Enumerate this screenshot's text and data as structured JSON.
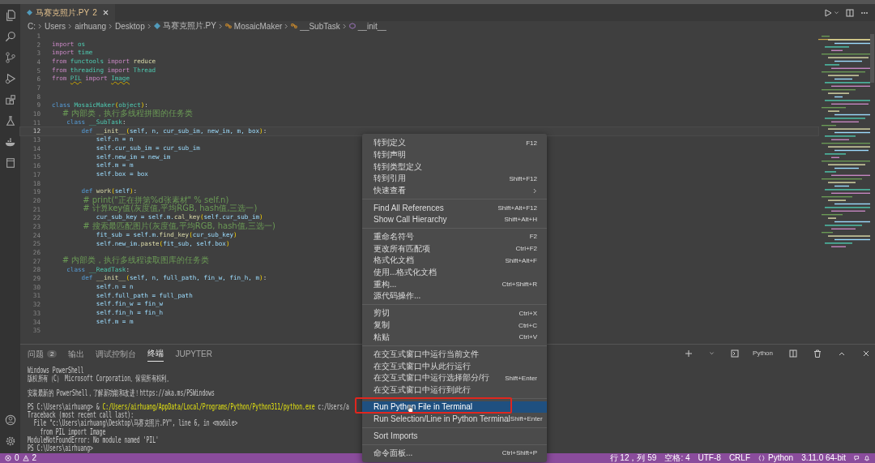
{
  "tab": {
    "title": "马赛克照片.PY",
    "problems": "2",
    "selected": true
  },
  "breadcrumbs": [
    {
      "kind": "folder",
      "text": "C:"
    },
    {
      "kind": "folder",
      "text": "Users"
    },
    {
      "kind": "folder",
      "text": "airhuang"
    },
    {
      "kind": "folder",
      "text": "Desktop"
    },
    {
      "kind": "file",
      "text": "马赛克照片.PY"
    },
    {
      "kind": "class",
      "text": "MosaicMaker"
    },
    {
      "kind": "class",
      "text": "__SubTask"
    },
    {
      "kind": "method",
      "text": "__init__"
    }
  ],
  "code_lines": [
    {
      "n": "1",
      "current": false
    },
    {
      "n": "2",
      "current": false,
      "tokens": [
        {
          "kind": "keyword",
          "text": "import"
        },
        {
          "kind": "type",
          "text": " os"
        }
      ]
    },
    {
      "n": "3",
      "current": false,
      "tokens": [
        {
          "kind": "keyword",
          "text": "import"
        },
        {
          "kind": "type",
          "text": " time"
        }
      ]
    },
    {
      "n": "4",
      "current": false,
      "tokens": [
        {
          "kind": "keyword",
          "text": "from"
        },
        {
          "kind": "type",
          "text": " functools"
        },
        {
          "kind": "keyword",
          "text": " import"
        },
        {
          "kind": "function",
          "text": " reduce"
        }
      ]
    },
    {
      "n": "5",
      "current": false,
      "tokens": [
        {
          "kind": "keyword",
          "text": "from"
        },
        {
          "kind": "type",
          "text": " threading"
        },
        {
          "kind": "keyword",
          "text": " import"
        },
        {
          "kind": "type",
          "text": " Thread"
        }
      ]
    },
    {
      "n": "6",
      "current": false,
      "tokens": [
        {
          "kind": "keyword",
          "text": "from "
        },
        {
          "kind": "warning",
          "text": "PIL"
        },
        {
          "kind": "keyword",
          "text": " import "
        },
        {
          "kind": "warning",
          "text": "Image"
        }
      ]
    },
    {
      "n": "7",
      "current": false
    },
    {
      "n": "8",
      "current": false
    },
    {
      "n": "9",
      "current": false,
      "tokens": [
        {
          "kind": "storage",
          "text": "class"
        },
        {
          "kind": "type",
          "text": " MosaicMaker"
        },
        {
          "kind": "bracket",
          "text": "("
        },
        {
          "kind": "type",
          "text": "object"
        },
        {
          "kind": "bracket",
          "text": ")"
        },
        {
          "kind": "plain",
          "text": ":"
        }
      ]
    },
    {
      "n": "10",
      "current": false,
      "tokens": [
        {
          "kind": "comment",
          "text": "    # 内部类，执行多线程拼图的任务类"
        }
      ]
    },
    {
      "n": "11",
      "current": false,
      "tokens": [
        {
          "kind": "storage",
          "text": "    class"
        },
        {
          "kind": "type",
          "text": " __SubTask"
        },
        {
          "kind": "plain",
          "text": ":"
        }
      ]
    },
    {
      "n": "12",
      "current": true,
      "tokens": [
        {
          "kind": "storage",
          "text": "        def"
        },
        {
          "kind": "function",
          "text": " __init__"
        },
        {
          "kind": "bracket",
          "text": "("
        },
        {
          "kind": "variable",
          "text": "self, n, cur_sub_im, new_im, m, box"
        },
        {
          "kind": "bracket",
          "text": ")"
        },
        {
          "kind": "plain",
          "text": ":"
        }
      ]
    },
    {
      "n": "13",
      "current": false,
      "tokens": [
        {
          "kind": "variable",
          "text": "            self.n = n"
        }
      ]
    },
    {
      "n": "14",
      "current": false,
      "tokens": [
        {
          "kind": "variable",
          "text": "            self.cur_sub_im = cur_sub_im"
        }
      ]
    },
    {
      "n": "15",
      "current": false,
      "tokens": [
        {
          "kind": "variable",
          "text": "            self.new_im = new_im"
        }
      ]
    },
    {
      "n": "16",
      "current": false,
      "tokens": [
        {
          "kind": "variable",
          "text": "            self.m = m"
        }
      ]
    },
    {
      "n": "17",
      "current": false,
      "tokens": [
        {
          "kind": "variable",
          "text": "            self.box = box"
        }
      ]
    },
    {
      "n": "18",
      "current": false
    },
    {
      "n": "19",
      "current": false,
      "tokens": [
        {
          "kind": "storage",
          "text": "        def"
        },
        {
          "kind": "function",
          "text": " work"
        },
        {
          "kind": "bracket",
          "text": "("
        },
        {
          "kind": "variable",
          "text": "self"
        },
        {
          "kind": "bracket",
          "text": ")"
        },
        {
          "kind": "plain",
          "text": ":"
        }
      ]
    },
    {
      "n": "20",
      "current": false,
      "tokens": [
        {
          "kind": "comment",
          "text": "            # print(\"正在拼第%d张素材\" % self.n)"
        }
      ]
    },
    {
      "n": "21",
      "current": false,
      "tokens": [
        {
          "kind": "comment",
          "text": "            # 计算key值(灰度值,平均RGB, hash值,三选一)"
        }
      ]
    },
    {
      "n": "22",
      "current": false,
      "tokens": [
        {
          "kind": "variable",
          "text": "            cur_sub_key = self.m."
        },
        {
          "kind": "function",
          "text": "cal_key"
        },
        {
          "kind": "bracket",
          "text": "("
        },
        {
          "kind": "variable",
          "text": "self.cur_sub_im"
        },
        {
          "kind": "bracket",
          "text": ")"
        }
      ]
    },
    {
      "n": "23",
      "current": false,
      "tokens": [
        {
          "kind": "comment",
          "text": "            # 搜索最匹配图片(灰度值,平均RGB, hash值,三选一)"
        }
      ]
    },
    {
      "n": "24",
      "current": false,
      "tokens": [
        {
          "kind": "variable",
          "text": "            fit_sub = self.m."
        },
        {
          "kind": "function",
          "text": "find_key"
        },
        {
          "kind": "bracket",
          "text": "("
        },
        {
          "kind": "variable",
          "text": "cur_sub_key"
        },
        {
          "kind": "bracket",
          "text": ")"
        }
      ]
    },
    {
      "n": "25",
      "current": false,
      "tokens": [
        {
          "kind": "variable",
          "text": "            self.new_im."
        },
        {
          "kind": "function",
          "text": "paste"
        },
        {
          "kind": "bracket",
          "text": "("
        },
        {
          "kind": "variable",
          "text": "fit_sub, self.box"
        },
        {
          "kind": "bracket",
          "text": ")"
        }
      ]
    },
    {
      "n": "26",
      "current": false
    },
    {
      "n": "27",
      "current": false,
      "tokens": [
        {
          "kind": "comment",
          "text": "    # 内部类，执行多线程读取图库的任务类"
        }
      ]
    },
    {
      "n": "28",
      "current": false,
      "tokens": [
        {
          "kind": "storage",
          "text": "    class"
        },
        {
          "kind": "type",
          "text": " __ReadTask"
        },
        {
          "kind": "plain",
          "text": ":"
        }
      ]
    },
    {
      "n": "29",
      "current": false,
      "tokens": [
        {
          "kind": "storage",
          "text": "        def"
        },
        {
          "kind": "function",
          "text": " __init__"
        },
        {
          "kind": "bracket",
          "text": "("
        },
        {
          "kind": "variable",
          "text": "self, n, full_path, fin_w, fin_h, m"
        },
        {
          "kind": "bracket",
          "text": ")"
        },
        {
          "kind": "plain",
          "text": ":"
        }
      ]
    },
    {
      "n": "30",
      "current": false,
      "tokens": [
        {
          "kind": "variable",
          "text": "            self.n = n"
        }
      ]
    },
    {
      "n": "31",
      "current": false,
      "tokens": [
        {
          "kind": "variable",
          "text": "            self.full_path = full_path"
        }
      ]
    },
    {
      "n": "32",
      "current": false,
      "tokens": [
        {
          "kind": "variable",
          "text": "            self.fin_w = fin_w"
        }
      ]
    },
    {
      "n": "33",
      "current": false,
      "tokens": [
        {
          "kind": "variable",
          "text": "            self.fin_h = fin_h"
        }
      ]
    },
    {
      "n": "34",
      "current": false,
      "tokens": [
        {
          "kind": "variable",
          "text": "            self.m = m"
        }
      ]
    },
    {
      "n": "35",
      "current": false
    }
  ],
  "panel_tabs": [
    {
      "label": "问题",
      "badge": "2",
      "selected": false
    },
    {
      "label": "输出",
      "selected": false
    },
    {
      "label": "调试控制台",
      "selected": false
    },
    {
      "label": "终端",
      "selected": true
    },
    {
      "label": "JUPYTER",
      "selected": false
    }
  ],
  "terminal_profile": "Python",
  "terminal_lines": [
    {
      "segments": [
        {
          "kind": "plain",
          "text": "Windows PowerShell"
        }
      ]
    },
    {
      "segments": [
        {
          "kind": "plain",
          "text": "版权所有（C） Microsoft Corporation。保留所有权利。"
        }
      ]
    },
    {
      "gap_before": true,
      "segments": [
        {
          "kind": "plain",
          "text": "安装最新的 PowerShell，了解新功能和改进！https://aka.ms/PSWindows"
        }
      ]
    },
    {
      "gap_before": true,
      "segments": [
        {
          "kind": "plain",
          "text": "PS C:\\Users\\airhuang> & "
        },
        {
          "kind": "path",
          "text": "C:/Users/airhuang/AppData/Local/Programs/Python/Python311/python.exe"
        },
        {
          "kind": "plain",
          "text": " c:/Users/a"
        }
      ]
    },
    {
      "segments": [
        {
          "kind": "plain",
          "text": "Traceback (most recent call last):"
        }
      ]
    },
    {
      "segments": [
        {
          "kind": "plain",
          "text": "  File \"c:\\Users\\airhuang\\Desktop\\马赛克照片.PY\", line 6, in <module>"
        }
      ]
    },
    {
      "segments": [
        {
          "kind": "plain",
          "text": "    from PIL import Image"
        }
      ]
    },
    {
      "segments": [
        {
          "kind": "plain",
          "text": "ModuleNotFoundError: No module named 'PIL'"
        }
      ]
    },
    {
      "segments": [
        {
          "kind": "plain",
          "text": "PS C:\\Users\\airhuang>"
        }
      ]
    }
  ],
  "context_menu": [
    [
      {
        "label": "转到定义",
        "shortcut": "F12",
        "selected": false
      },
      {
        "label": "转到声明",
        "selected": false
      },
      {
        "label": "转到类型定义",
        "selected": false
      },
      {
        "label": "转到引用",
        "shortcut": "Shift+F12",
        "selected": false
      },
      {
        "label": "快速查看",
        "submenu": true,
        "selected": false
      }
    ],
    [
      {
        "label": "Find All References",
        "shortcut": "Shift+Alt+F12",
        "selected": false
      },
      {
        "label": "Show Call Hierarchy",
        "shortcut": "Shift+Alt+H",
        "selected": false
      }
    ],
    [
      {
        "label": "重命名符号",
        "shortcut": "F2",
        "selected": false
      },
      {
        "label": "更改所有匹配项",
        "shortcut": "Ctrl+F2",
        "selected": false
      },
      {
        "label": "格式化文档",
        "shortcut": "Shift+Alt+F",
        "selected": false
      },
      {
        "label": "使用...格式化文档",
        "selected": false
      },
      {
        "label": "重构...",
        "shortcut": "Ctrl+Shift+R",
        "selected": false
      },
      {
        "label": "源代码操作...",
        "selected": false
      }
    ],
    [
      {
        "label": "剪切",
        "shortcut": "Ctrl+X",
        "selected": false
      },
      {
        "label": "复制",
        "shortcut": "Ctrl+C",
        "selected": false
      },
      {
        "label": "粘贴",
        "shortcut": "Ctrl+V",
        "selected": false
      }
    ],
    [
      {
        "label": "在交互式窗口中运行当前文件",
        "selected": false
      },
      {
        "label": "在交互式窗口中从此行运行",
        "selected": false
      },
      {
        "label": "在交互式窗口中运行选择部分/行",
        "shortcut": "Shift+Enter",
        "selected": false
      },
      {
        "label": "在交互式窗口中运行到此行",
        "selected": false
      }
    ],
    [
      {
        "label": "Run Python File in Terminal",
        "selected": true,
        "circled": true
      },
      {
        "label": "Run Selection/Line in Python Terminal",
        "shortcut": "Shift+Enter",
        "selected": false,
        "circled": false
      }
    ],
    [
      {
        "label": "Sort Imports",
        "selected": false
      }
    ],
    [
      {
        "label": "命令面板...",
        "shortcut": "Ctrl+Shift+P",
        "selected": false
      }
    ]
  ],
  "status_bar": {
    "errors": "0",
    "warnings": "2",
    "right": [
      {
        "kind": "text",
        "text": "行 12，列 59"
      },
      {
        "kind": "text",
        "text": "空格: 4"
      },
      {
        "kind": "text",
        "text": "UTF-8"
      },
      {
        "kind": "text",
        "text": "CRLF"
      },
      {
        "kind": "language",
        "text": "Python"
      },
      {
        "kind": "text",
        "text": "3.11.0 64-bit"
      }
    ]
  }
}
